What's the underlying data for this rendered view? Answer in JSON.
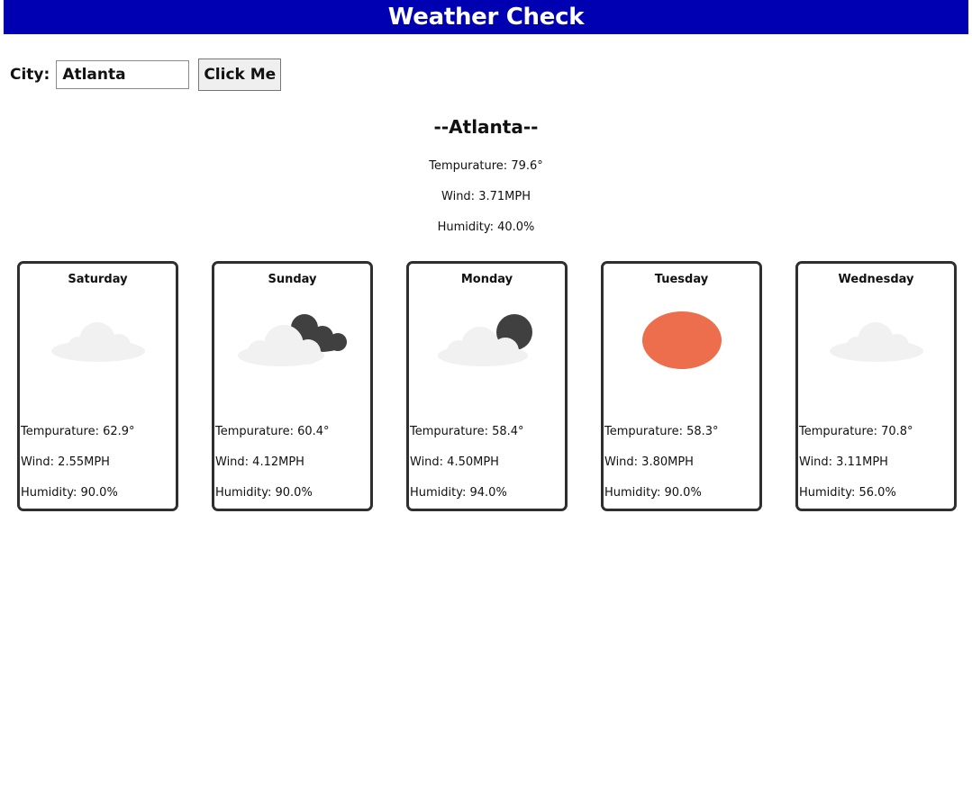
{
  "header": {
    "title": "Weather Check"
  },
  "search": {
    "label": "City:",
    "value": "Atlanta",
    "button_label": "Click Me"
  },
  "current": {
    "city_heading": "--Atlanta--",
    "temperature": "Tempurature: 79.6°",
    "wind": "Wind: 3.71MPH",
    "humidity": "Humidity: 40.0%"
  },
  "forecast": [
    {
      "day": "Saturday",
      "icon": "cloud-icon",
      "temperature": "Tempurature: 62.9°",
      "wind": "Wind: 2.55MPH",
      "humidity": "Humidity: 90.0%"
    },
    {
      "day": "Sunday",
      "icon": "broken-clouds-icon",
      "temperature": "Tempurature: 60.4°",
      "wind": "Wind: 4.12MPH",
      "humidity": "Humidity: 90.0%"
    },
    {
      "day": "Monday",
      "icon": "scattered-clouds-icon",
      "temperature": "Tempurature: 58.4°",
      "wind": "Wind: 4.50MPH",
      "humidity": "Humidity: 94.0%"
    },
    {
      "day": "Tuesday",
      "icon": "sun-icon",
      "temperature": "Tempurature: 58.3°",
      "wind": "Wind: 3.80MPH",
      "humidity": "Humidity: 90.0%"
    },
    {
      "day": "Wednesday",
      "icon": "cloud-icon",
      "temperature": "Tempurature: 70.8°",
      "wind": "Wind: 3.11MPH",
      "humidity": "Humidity: 56.0%"
    }
  ],
  "colors": {
    "header_bg": "#0000b3",
    "card_border": "#2f2f2f",
    "cloud_light": "#f1f1f1",
    "cloud_dark": "#404040",
    "sun": "#ec6e4c"
  }
}
